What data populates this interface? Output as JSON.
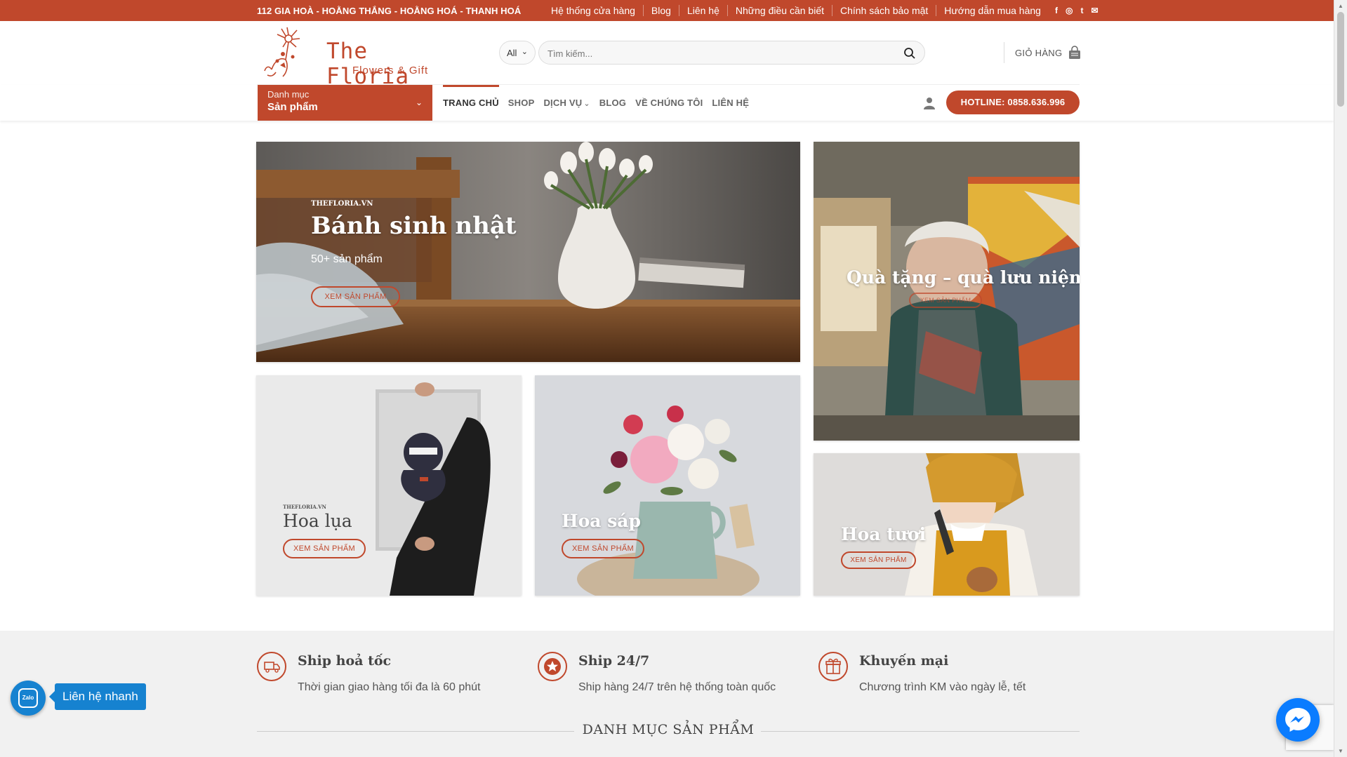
{
  "topbar": {
    "address": "112 GIA HOÀ - HOẰNG THẮNG - HOẰNG HOÁ - THANH HOÁ",
    "links": [
      "Hệ thống cửa hàng",
      "Blog",
      "Liên hệ",
      "Những điều cần biết",
      "Chính sách bảo mật",
      "Hướng dẫn mua hàng"
    ],
    "social_icons": [
      "facebook-icon",
      "instagram-icon",
      "twitter-icon",
      "email-icon"
    ],
    "social_glyphs": [
      "f",
      "◎",
      "t",
      "✉"
    ]
  },
  "header": {
    "logo_name": "The Floria",
    "logo_tagline": "Flowers & Gift",
    "search_category": "All",
    "search_placeholder": "Tìm kiếm...",
    "cart_label": "GIỎ HÀNG"
  },
  "nav": {
    "category_small": "Danh mục",
    "category_big": "Sản phẩm",
    "items": [
      "TRANG CHỦ",
      "SHOP",
      "DỊCH VỤ",
      "BLOG",
      "VỀ CHÚNG TÔI",
      "LIÊN HỆ"
    ],
    "active_index": 0,
    "hotline": "HOTLINE: 0858.636.996"
  },
  "banners": {
    "cake": {
      "site": "THEFLORIA.VN",
      "title": "Bánh sinh nhật",
      "subtitle": "50+ sản phẩm",
      "button": "XEM SẢN PHẨM"
    },
    "gift": {
      "title": "Quà tặng – quà lưu niệm",
      "button": "XEM SẢN PHẨM"
    },
    "silk": {
      "site": "THEFLORIA.VN",
      "title": "Hoa lụa",
      "button": "XEM SẢN PHẨM"
    },
    "wax": {
      "title": "Hoa sáp",
      "button": "XEM SẢN PHẨM"
    },
    "fresh": {
      "title": "Hoa tươi",
      "button": "XEM SẢN PHẨM"
    }
  },
  "features": [
    {
      "title": "Ship hoả tốc",
      "desc": "Thời gian giao hàng tối đa là 60 phút",
      "icon": "truck-icon"
    },
    {
      "title": "Ship 24/7",
      "desc": "Ship hàng 24/7 trên hệ thống toàn quốc",
      "icon": "star-icon"
    },
    {
      "title": "Khuyến mại",
      "desc": "Chương trình KM vào ngày lễ, tết",
      "icon": "gift-icon"
    }
  ],
  "section_title": "DANH MỤC SẢN PHẨM",
  "widgets": {
    "zalo_label": "Zalo",
    "quick_contact": "Liên hệ nhanh"
  },
  "colors": {
    "brand": "#c0482c",
    "zalo": "#1682d0",
    "messenger": "#0a7cff"
  }
}
